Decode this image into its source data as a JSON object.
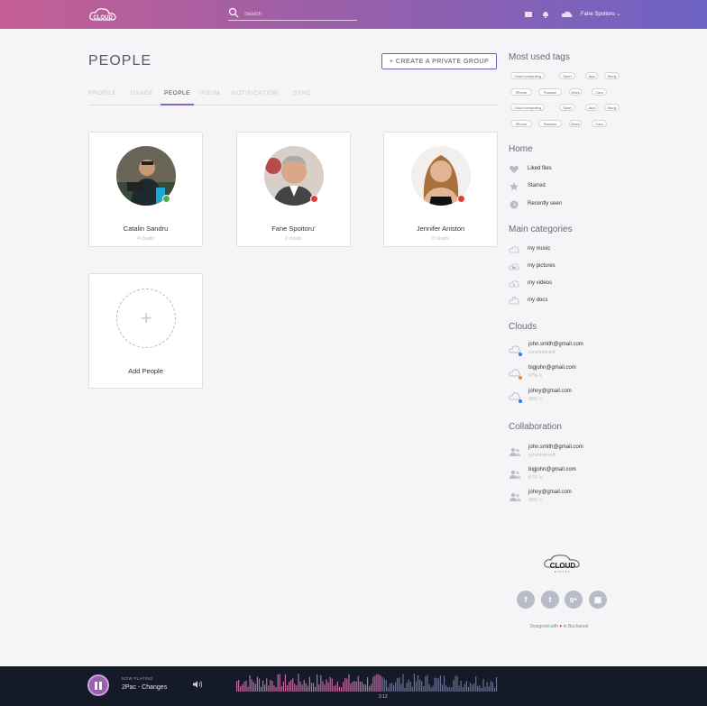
{
  "header": {
    "search_placeholder": "Search",
    "user_name": "Fane Spoitoru ⌄"
  },
  "page": {
    "title": "PEOPLE",
    "create_button": "+ CREATE A PRIVATE GROUP",
    "tabs": [
      {
        "label": "PROFILE",
        "active": false
      },
      {
        "label": "USAGE",
        "active": false
      },
      {
        "label": "PEOPLE",
        "active": true
      },
      {
        "label": "IPSUM",
        "active": false
      },
      {
        "label": "NOTIFICATION",
        "active": false
      },
      {
        "label": "SYNC",
        "active": false
      }
    ],
    "people": [
      {
        "name": "Catalin Sandru",
        "clouds": "4 clouds",
        "status_color": "#4caf50"
      },
      {
        "name": "Fane Spoitoru'",
        "clouds": "2 clouds",
        "status_color": "#e53935"
      },
      {
        "name": "Jennifer Aniston",
        "clouds": "0 clouds",
        "status_color": "#e53935"
      }
    ],
    "add_people": "Add People"
  },
  "sidebar": {
    "tags_title": "Most used tags",
    "tags": [
      [
        "Cloud computing",
        "Sport",
        "Jazz",
        "Study"
      ],
      [
        "iPhone",
        "Passion",
        "Work",
        "Cars"
      ],
      [
        "Cloud computing",
        "Sport",
        "Jazz",
        "Study"
      ],
      [
        "iPhone",
        "Passion",
        "Work",
        "Cars"
      ]
    ],
    "home_title": "Home",
    "home_items": [
      "Liked files",
      "Starred",
      "Recently seen"
    ],
    "categories_title": "Main categories",
    "categories": [
      "my music",
      "my pictures",
      "my videos",
      "my docs"
    ],
    "clouds_title": "Clouds",
    "clouds": [
      {
        "email": "john.smith@gmail.com",
        "status": "synchronised",
        "dot": "#2f7de1"
      },
      {
        "email": "bigjohn@gmail.com",
        "status": "67% ↻",
        "dot": "#e8892c"
      },
      {
        "email": "johny@gmail.com",
        "status": "95% ↻",
        "dot": "#2f7de1"
      }
    ],
    "collab_title": "Collaboration",
    "collab": [
      {
        "email": "john.smith@gmail.com",
        "status": "synchronised"
      },
      {
        "email": "bigjohn@gmail.com",
        "status": "67% ↻"
      },
      {
        "email": "johny@gmail.com",
        "status": "95% ↻"
      }
    ],
    "footer": {
      "social": [
        "f",
        "t",
        "g+",
        "▣"
      ],
      "designed_pre": "Designed with",
      "designed_post": "in Bucharest"
    }
  },
  "player": {
    "now_playing_label": "NOW PLAYING",
    "track": "2Pac - Changes",
    "time": "2:12",
    "progress": 0.56
  },
  "colors": {
    "accent": "#8a63c7",
    "header_start": "#c55f95",
    "header_end": "#6e63c4"
  }
}
